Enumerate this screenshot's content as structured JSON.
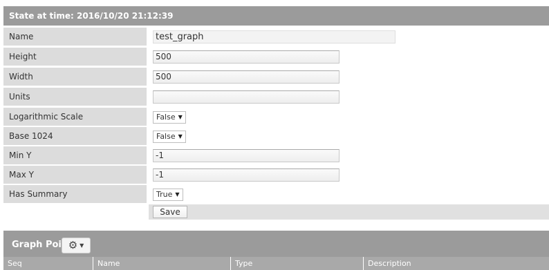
{
  "state_header": "State at time: 2016/10/20 21:12:39",
  "fields": [
    {
      "label": "Name",
      "type": "text",
      "value": "test_graph"
    },
    {
      "label": "Height",
      "type": "text",
      "value": "500"
    },
    {
      "label": "Width",
      "type": "text",
      "value": "500"
    },
    {
      "label": "Units",
      "type": "text",
      "value": ""
    },
    {
      "label": "Logarithmic Scale",
      "type": "select",
      "value": "False"
    },
    {
      "label": "Base 1024",
      "type": "select",
      "value": "False"
    },
    {
      "label": "Min Y",
      "type": "text",
      "value": "-1"
    },
    {
      "label": "Max Y",
      "type": "text",
      "value": "-1"
    },
    {
      "label": "Has Summary",
      "type": "select",
      "value": "True"
    }
  ],
  "save_label": "Save",
  "graph_points": {
    "title": "Graph Points",
    "columns": [
      "Seq",
      "Name",
      "Type",
      "Description"
    ]
  }
}
